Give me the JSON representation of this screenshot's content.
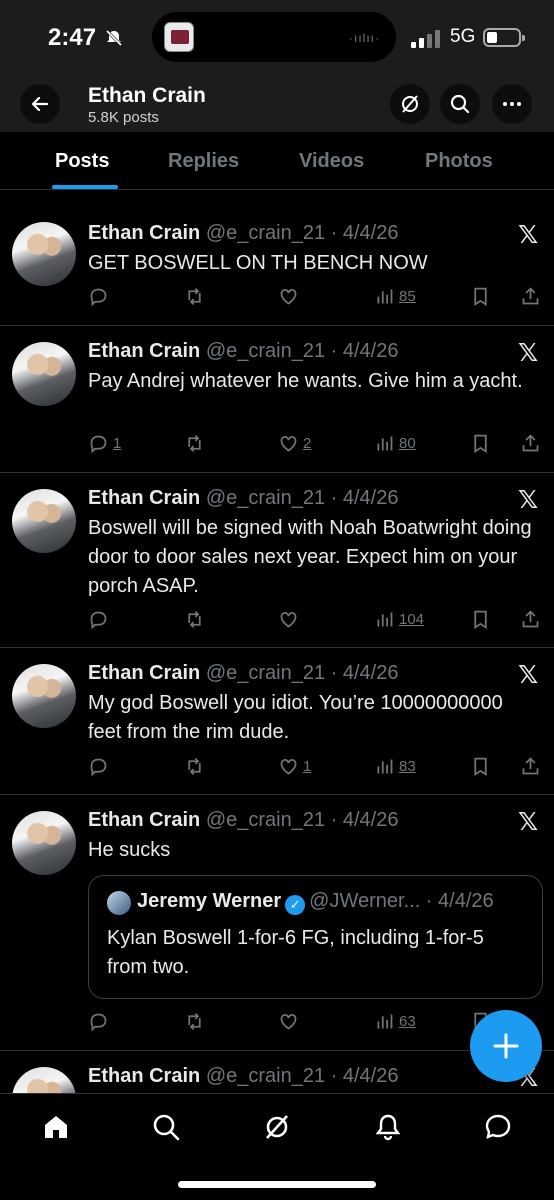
{
  "status_bar": {
    "time": "2:47",
    "network": "5G"
  },
  "header": {
    "name": "Ethan Crain",
    "posts": "5.8K posts"
  },
  "tabs": [
    {
      "label": "Posts"
    },
    {
      "label": "Replies"
    },
    {
      "label": "Videos"
    },
    {
      "label": "Photos"
    }
  ],
  "tweets": [
    {
      "name": "Ethan Crain",
      "handle_date": "@e_crain_21 · 4/4/26",
      "text": "GET BOSWELL ON TH BENCH NOW",
      "replies": "",
      "likes": "",
      "views": "85"
    },
    {
      "name": "Ethan Crain",
      "handle_date": "@e_crain_21 · 4/4/26",
      "text": "Pay Andrej whatever he wants. Give him a yacht.",
      "replies": "1",
      "likes": "2",
      "views": "80"
    },
    {
      "name": "Ethan Crain",
      "handle_date": "@e_crain_21 · 4/4/26",
      "text": "Boswell will be signed with Noah Boatwright doing door to door sales next year. Expect him on your porch ASAP.",
      "replies": "",
      "likes": "",
      "views": "104"
    },
    {
      "name": "Ethan Crain",
      "handle_date": "@e_crain_21 · 4/4/26",
      "text": "My god Boswell you idiot. You’re 10000000000 feet from the rim dude.",
      "replies": "",
      "likes": "1",
      "views": "83"
    },
    {
      "name": "Ethan Crain",
      "handle_date": "@e_crain_21 · 4/4/26",
      "text": "He sucks",
      "replies": "",
      "likes": "",
      "views": "63",
      "quote": {
        "name": "Jeremy Werner",
        "handle_date": "@JWerner... · 4/4/26",
        "text": "Kylan Boswell 1-for-6 FG, including 1-for-5 from two."
      }
    },
    {
      "name": "Ethan Crain",
      "handle_date": "@e_crain_21 · 4/4/26",
      "text": ""
    }
  ],
  "icons": {
    "accent": "#1d9bf0",
    "muted": "#71767b"
  }
}
